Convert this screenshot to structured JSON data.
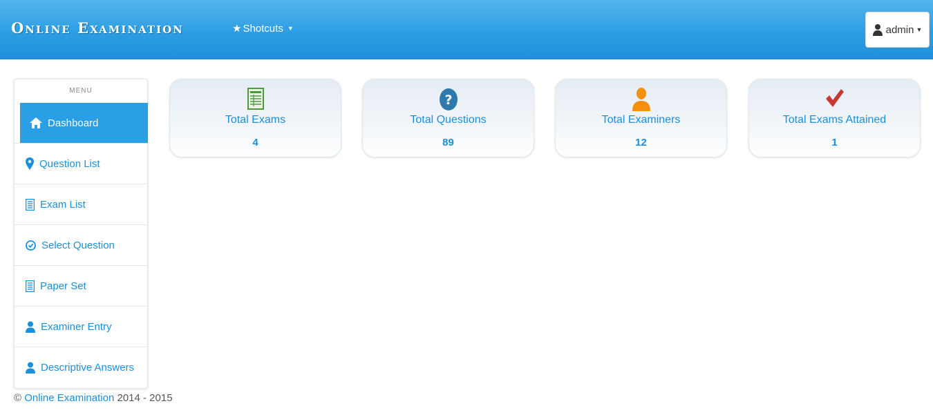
{
  "header": {
    "brand": "Online Examination",
    "shortcuts_label": "Shotcuts",
    "user_label": "admin"
  },
  "sidebar": {
    "title": "MENU",
    "items": [
      {
        "label": "Dashboard",
        "icon": "home-icon",
        "active": true
      },
      {
        "label": "Question List",
        "icon": "marker-icon",
        "active": false
      },
      {
        "label": "Exam List",
        "icon": "document-icon",
        "active": false
      },
      {
        "label": "Select Question",
        "icon": "check-circle-icon",
        "active": false
      },
      {
        "label": "Paper Set",
        "icon": "document-icon",
        "active": false
      },
      {
        "label": "Examiner Entry",
        "icon": "user-icon",
        "active": false
      },
      {
        "label": "Descriptive Answers",
        "icon": "user-icon",
        "active": false
      }
    ]
  },
  "stats": [
    {
      "label": "Total Exams",
      "value": "4",
      "icon": "spreadsheet-icon"
    },
    {
      "label": "Total Questions",
      "value": "89",
      "icon": "question-circle-icon"
    },
    {
      "label": "Total Examiners",
      "value": "12",
      "icon": "user-icon"
    },
    {
      "label": "Total Exams Attained",
      "value": "1",
      "icon": "checkmark-icon"
    }
  ],
  "footer": {
    "copyright_symbol": "©",
    "link_text": "Online Examination",
    "years": "2014 - 2015"
  },
  "colors": {
    "header_top": "#52b4ec",
    "header_bottom": "#1f8fdc",
    "accent": "#1a8fdc",
    "active_menu": "#2b9fe6",
    "exam_icon": "#4a9a3c",
    "question_icon": "#2f79ad",
    "examiner_icon": "#f5900f",
    "check_icon": "#c63a33"
  }
}
